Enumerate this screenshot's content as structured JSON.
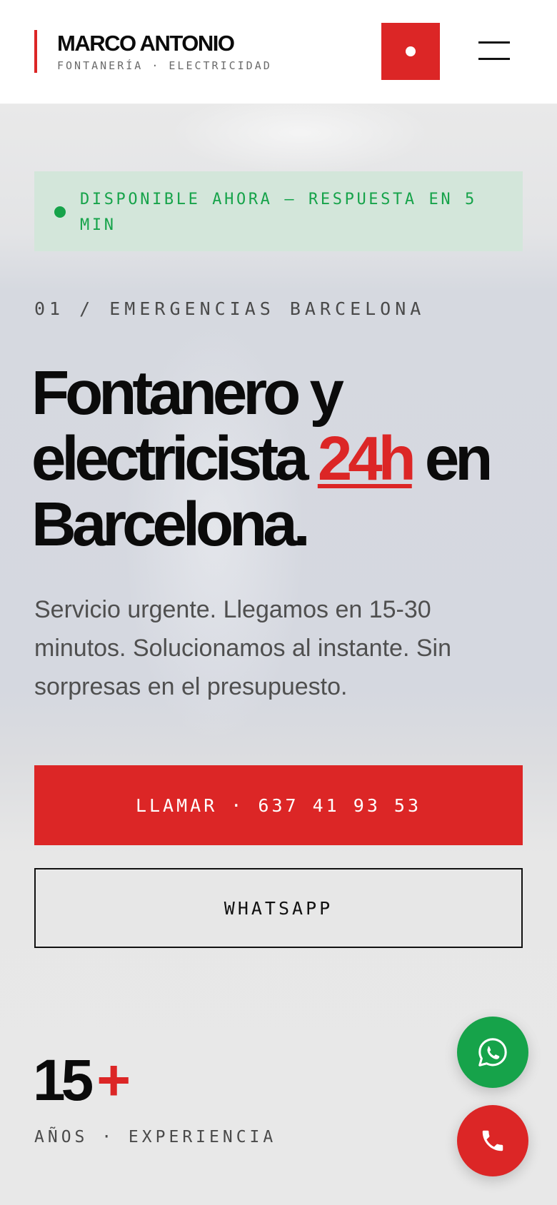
{
  "header": {
    "brand_name": "MARCO ANTONIO",
    "brand_tagline": "FONTANERÍA · ELECTRICIDAD",
    "call_icon": "record-dot-icon",
    "menu_icon": "hamburger-menu-icon"
  },
  "hero": {
    "status": "DISPONIBLE AHORA — RESPUESTA EN 5 MIN",
    "eyebrow": "01 / EMERGENCIAS BARCELONA",
    "headline": {
      "part1": "Fontanero y electricista ",
      "accent": "24h",
      "part2": " en Barcelona."
    },
    "subtitle": "Servicio urgente. Llegamos en 15-30 minutos. Solucionamos al instante. Sin sorpresas en el presupuesto.",
    "primary_button": "LLAMAR · 637 41 93 53",
    "secondary_button": "WHATSAPP"
  },
  "stats": {
    "number": "15",
    "suffix": "+",
    "label": "AÑOS · EXPERIENCIA"
  },
  "floating": {
    "whatsapp_icon": "whatsapp-icon",
    "phone_icon": "phone-icon"
  },
  "colors": {
    "accent": "#dc2626",
    "success": "#16a34a",
    "text": "#0b0b0b"
  }
}
